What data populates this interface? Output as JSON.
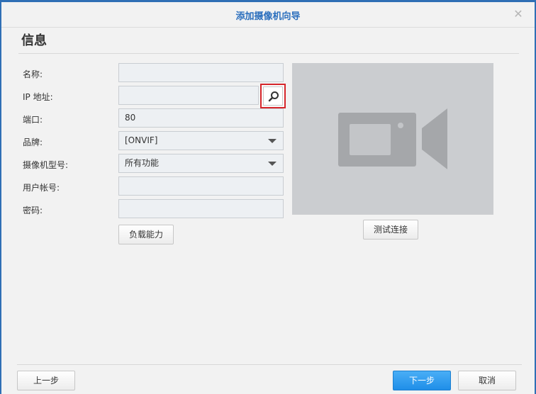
{
  "window": {
    "title": "添加摄像机向导",
    "close_icon": "close-icon"
  },
  "section": {
    "title": "信息"
  },
  "form": {
    "name": {
      "label": "名称:",
      "value": ""
    },
    "ip": {
      "label": "IP 地址:",
      "value": "",
      "search_icon": "search-icon"
    },
    "port": {
      "label": "端口:",
      "value": "80"
    },
    "brand": {
      "label": "品牌:",
      "value": "[ONVIF]"
    },
    "model": {
      "label": "摄像机型号:",
      "value": "所有功能"
    },
    "username": {
      "label": "用户帐号:",
      "value": ""
    },
    "password": {
      "label": "密码:",
      "value": ""
    },
    "load_button": "负载能力"
  },
  "preview": {
    "icon": "video-camera-icon",
    "test_button": "测试连接"
  },
  "footer": {
    "prev": "上一步",
    "next": "下一步",
    "cancel": "取消"
  },
  "colors": {
    "accent": "#2a6ebd",
    "primary_button": "#2b96ec",
    "highlight_border": "#d6262b"
  }
}
